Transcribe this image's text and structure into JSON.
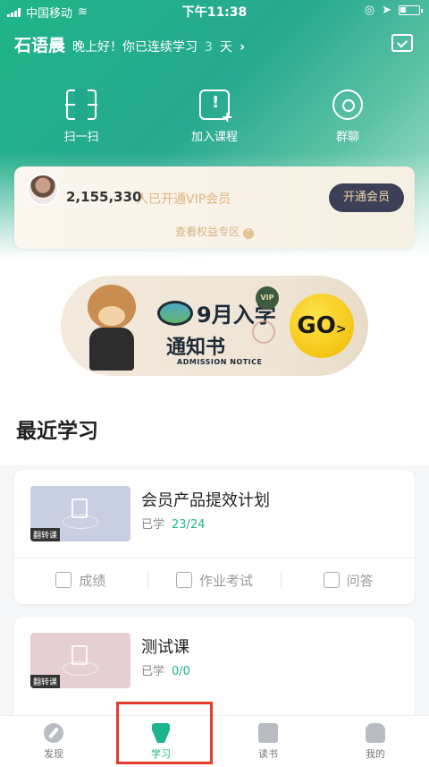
{
  "status_bar": {
    "carrier": "中国移动",
    "time": "下午11:38"
  },
  "greeting": {
    "name": "石语晨",
    "message": "晚上好！你已连续学习",
    "days": "3",
    "unit": "天",
    "chevron": "›"
  },
  "actions": [
    {
      "label": "扫一扫",
      "icon": "scan-icon"
    },
    {
      "label": "加入课程",
      "icon": "add-course-icon"
    },
    {
      "label": "群聊",
      "icon": "group-chat-icon"
    }
  ],
  "vip": {
    "count": "2,155,330",
    "text": "人已开通VIP会员",
    "button": "开通会员",
    "link": "查看权益专区",
    "link_icon": "⌃"
  },
  "banner": {
    "title_line1": "9月入学",
    "title_line2": "通知书",
    "subtitle": "ADMISSION NOTICE",
    "badge": "VIP",
    "go": "GO",
    "go_arrow": ">"
  },
  "recent": {
    "title": "最近学习",
    "courses": [
      {
        "title": "会员产品提效计划",
        "progress_label": "已学",
        "progress": "23/24",
        "tag": "翻转课"
      },
      {
        "title": "测试课",
        "progress_label": "已学",
        "progress": "0/0",
        "tag": "翻转课"
      }
    ],
    "sub_actions": [
      "成绩",
      "作业考试",
      "问答"
    ]
  },
  "tabs": [
    {
      "label": "发现",
      "icon": "compass-icon"
    },
    {
      "label": "学习",
      "icon": "pen-nib-icon",
      "active": true
    },
    {
      "label": "读书",
      "icon": "book-icon"
    },
    {
      "label": "我的",
      "icon": "user-icon"
    }
  ],
  "colors": {
    "accent": "#1cb48a",
    "highlight": "#e53a2e",
    "vip_button": "#3b3f58",
    "vip_text": "#e0b57e"
  }
}
